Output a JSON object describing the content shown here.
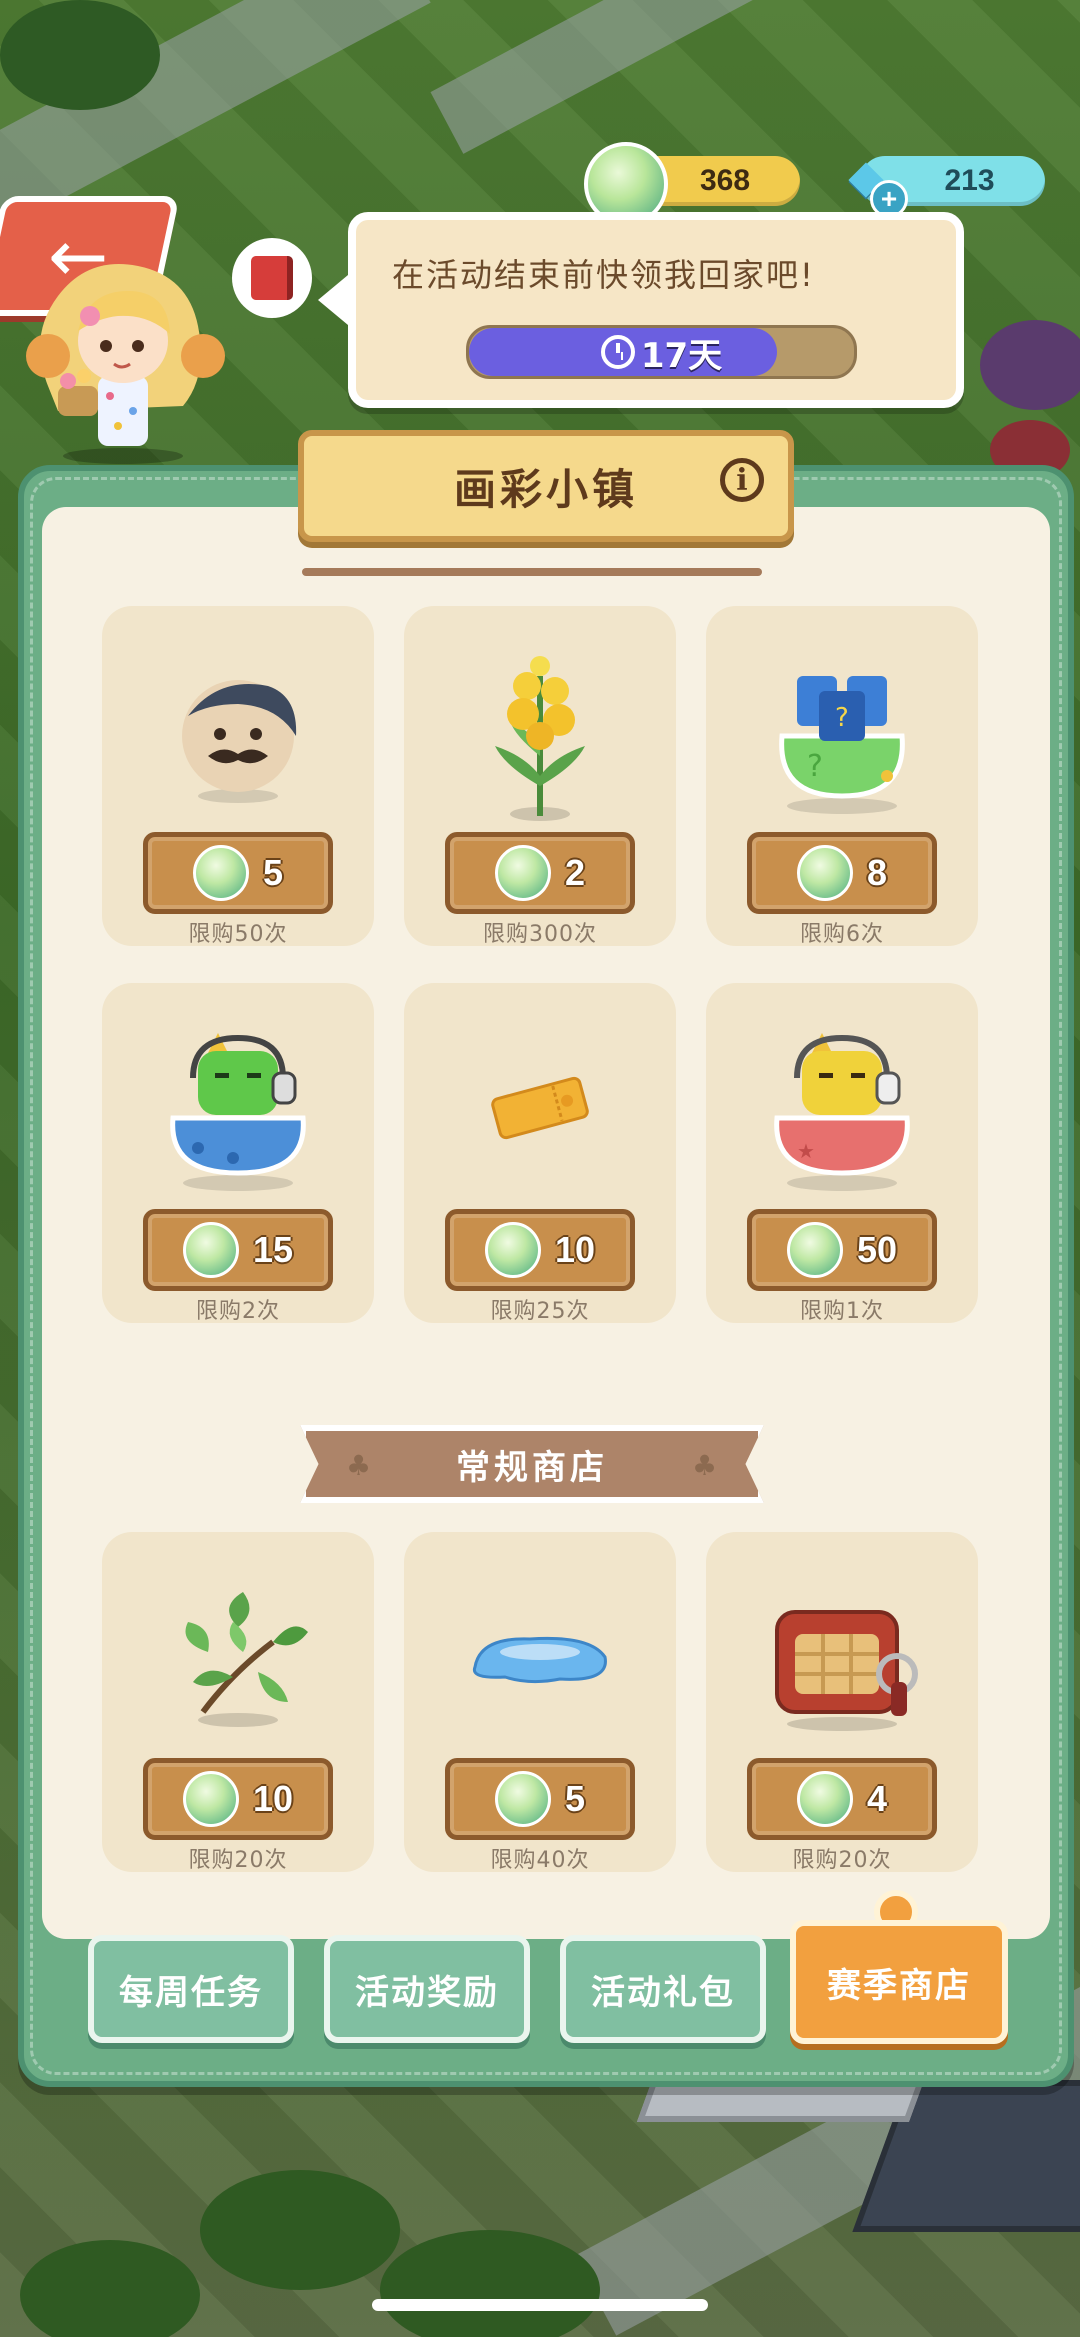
{
  "top_bar": {
    "seed_count": "368",
    "gem_count": "213"
  },
  "speech": {
    "text": "在活动结束前快领我回家吧!",
    "timer_label": "17天",
    "timer_progress": 0.8
  },
  "shop": {
    "title": "画彩小镇",
    "event_items": [
      {
        "icon": "mustache-pug-icon",
        "price": "5",
        "limit": "限购50次"
      },
      {
        "icon": "yellow-flower-plant-icon",
        "price": "2",
        "limit": "限购300次"
      },
      {
        "icon": "mystery-bag-icon",
        "price": "8",
        "limit": "限购6次"
      },
      {
        "icon": "blue-robot-cat-bag-icon",
        "price": "15",
        "limit": "限购2次"
      },
      {
        "icon": "golden-ticket-icon",
        "price": "10",
        "limit": "限购25次"
      },
      {
        "icon": "red-robot-cat-bag-icon",
        "price": "50",
        "limit": "限购1次"
      }
    ],
    "regular_section_title": "常规商店",
    "regular_items": [
      {
        "icon": "leafy-branch-icon",
        "price": "10",
        "limit": "限购20次"
      },
      {
        "icon": "water-puddle-icon",
        "price": "5",
        "limit": "限购40次"
      },
      {
        "icon": "radio-box-icon",
        "price": "4",
        "limit": "限购20次"
      }
    ]
  },
  "tabs": [
    {
      "label": "每周任务",
      "active": false
    },
    {
      "label": "活动奖励",
      "active": false
    },
    {
      "label": "活动礼包",
      "active": false
    },
    {
      "label": "赛季商店",
      "active": true
    }
  ],
  "colors": {
    "panel_green": "#6cae86",
    "active_tab": "#f2a03f",
    "price_plate": "#c88f4c",
    "timer_fill": "#6b5fe0"
  }
}
